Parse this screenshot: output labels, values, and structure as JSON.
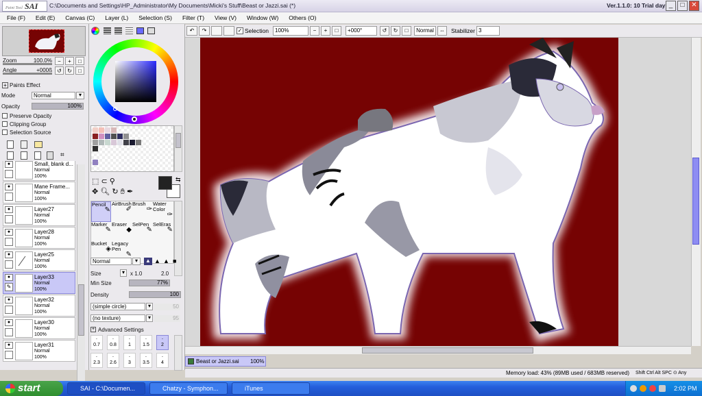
{
  "window": {
    "title": "C:\\Documents and Settings\\HP_Administrator\\My Documents\\Micki's Stuff\\Beast or Jazzi.sai (*)",
    "version": "Ver.1.1.0: 10 Trial day",
    "logo": "SAI",
    "logo_small": "Paint Tool",
    "min": "_",
    "max": "□",
    "close": "✕"
  },
  "menu": [
    "File (F)",
    "Edit (E)",
    "Canvas (C)",
    "Layer (L)",
    "Selection (S)",
    "Filter (T)",
    "View (V)",
    "Window (W)",
    "Others (O)"
  ],
  "toolbar": {
    "selection_label": "Selection",
    "zoom": "100%",
    "angle": "+000°",
    "blend": "Normal",
    "stabilizer_label": "Stabilizer",
    "stabilizer": "3"
  },
  "navigator": {
    "zoom_label": "Zoom",
    "zoom": "100.0%",
    "angle_label": "Angle",
    "angle": "+000ß"
  },
  "paints_effect": "Paints Effect",
  "layer_panel": {
    "mode_label": "Mode",
    "mode": "Normal",
    "opacity_label": "Opacity",
    "opacity": "100%",
    "preserve_opacity": "Preserve Opacity",
    "clipping_group": "Clipping Group",
    "selection_source": "Selection Source"
  },
  "layers": [
    {
      "name": "Small, blank d...",
      "mode": "Normal",
      "opacity": "100%"
    },
    {
      "name": "Mane Frame...",
      "mode": "Normal",
      "opacity": "100%"
    },
    {
      "name": "Layer27",
      "mode": "Normal",
      "opacity": "100%"
    },
    {
      "name": "Layer28",
      "mode": "Normal",
      "opacity": "100%"
    },
    {
      "name": "Layer25",
      "mode": "Normal",
      "opacity": "100%"
    },
    {
      "name": "Layer33",
      "mode": "Normal",
      "opacity": "100%"
    },
    {
      "name": "Layer32",
      "mode": "Normal",
      "opacity": "100%"
    },
    {
      "name": "Layer30",
      "mode": "Normal",
      "opacity": "100%"
    },
    {
      "name": "Layer31",
      "mode": "Normal",
      "opacity": "100%"
    }
  ],
  "tools": [
    {
      "label": "Pencil"
    },
    {
      "label": "AirBrush"
    },
    {
      "label": "Brush"
    },
    {
      "label": "Water Color"
    },
    {
      "label": "Marker"
    },
    {
      "label": "Eraser"
    },
    {
      "label": "SelPen"
    },
    {
      "label": "SelEras"
    },
    {
      "label": "Bucket"
    },
    {
      "label": "Legacy Pen"
    }
  ],
  "brush": {
    "blend": "Normal",
    "size_label": "Size",
    "size_mult": "x 1.0",
    "size": "2.0",
    "minsize_label": "Min Size",
    "minsize": "77%",
    "density_label": "Density",
    "density": "100",
    "shape": "(simple circle)",
    "shape_val": "50",
    "texture": "(no texture)",
    "texture_val": "95",
    "advanced": "Advanced Settings"
  },
  "brush_sizes": [
    "0.7",
    "0.8",
    "1",
    "1.5",
    "2",
    "2.3",
    "2.6",
    "3",
    "3.5",
    "4"
  ],
  "colors": {
    "primary": "#222222",
    "secondary": "#ffffff",
    "canvas_bg": "#760303",
    "accent": "#c9c8f7"
  },
  "swatches": [
    "#f2d0c8",
    "#f4c0b8",
    "#e8d8e0",
    "#d8b8b8",
    "#8a2020",
    "#d090c0",
    "#6060a0",
    "#505050",
    "#303060",
    "#909090",
    "#a0a0a0",
    "#b0b8b8",
    "#c8d8d0",
    "#d8c8d8",
    "#e0e0e8",
    "#404048",
    "#1a1a30",
    "#7a7a7a",
    "#303030",
    "#9080c0"
  ],
  "document": {
    "tab": "Beast or Jazzi.sai",
    "zoom": "100%"
  },
  "status": {
    "memory": "Memory load: 43% (89MB used / 683MB reserved)",
    "keys": "Shift Ctrl Alt SPC ⊙ Any"
  },
  "taskbar": {
    "start": "start",
    "tasks": [
      "SAI - C:\\Documen...",
      "Chatzy - Symphon...",
      "iTunes"
    ],
    "clock": "2:02 PM"
  }
}
